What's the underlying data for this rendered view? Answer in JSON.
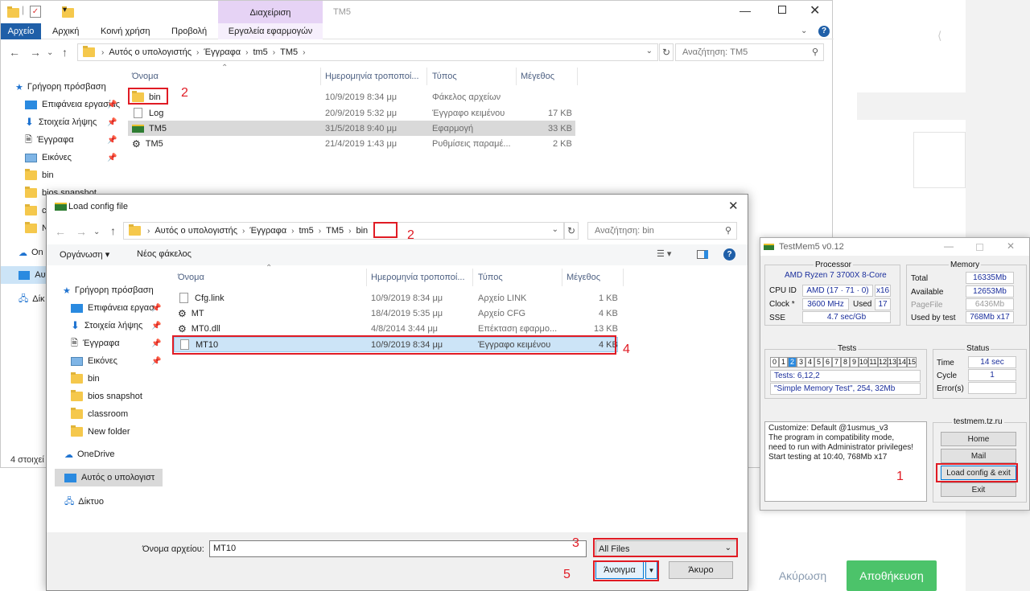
{
  "web": {
    "cancel_label": "Ακύρωση",
    "save_label": "Αποθήκευση"
  },
  "explorer": {
    "ribbon_context": "Διαχείριση",
    "window_title": "TM5",
    "tabs": [
      "Αρχείο",
      "Αρχική",
      "Κοινή χρήση",
      "Προβολή",
      "Εργαλεία εφαρμογών"
    ],
    "breadcrumb": [
      "Αυτός ο υπολογιστής",
      "Έγγραφα",
      "tm5",
      "TM5"
    ],
    "search_placeholder": "Αναζήτηση: TM5",
    "columns": [
      "Όνομα",
      "Ημερομηνία τροποποί...",
      "Τύπος",
      "Μέγεθος"
    ],
    "sidebar": [
      {
        "label": "Γρήγορη πρόσβαση",
        "icon": "star-icon"
      },
      {
        "label": "Επιφάνεια εργασίας",
        "icon": "desktop-icon",
        "pinned": true
      },
      {
        "label": "Στοιχεία λήψης",
        "icon": "download-icon",
        "pinned": true
      },
      {
        "label": "Έγγραφα",
        "icon": "document-icon",
        "pinned": true
      },
      {
        "label": "Εικόνες",
        "icon": "pictures-icon",
        "pinned": true
      },
      {
        "label": "bin",
        "icon": "folder-icon"
      },
      {
        "label": "bios snapshot",
        "icon": "folder-icon"
      },
      {
        "label": "cl",
        "icon": "folder-icon"
      },
      {
        "label": "N",
        "icon": "folder-icon"
      },
      {
        "label": "On",
        "icon": "onedrive-icon"
      },
      {
        "label": "Αυτ",
        "icon": "computer-icon"
      },
      {
        "label": "Δίκ",
        "icon": "network-icon"
      }
    ],
    "files": [
      {
        "name": "bin",
        "date": "10/9/2019 8:34 μμ",
        "type": "Φάκελος αρχείων",
        "size": "",
        "icon": "folder-icon"
      },
      {
        "name": "Log",
        "date": "20/9/2019 5:32 μμ",
        "type": "Έγγραφο κειμένου",
        "size": "17 KB",
        "icon": "text-file-icon"
      },
      {
        "name": "TM5",
        "date": "31/5/2018 9:40 μμ",
        "type": "Εφαρμογή",
        "size": "33 KB",
        "icon": "ram-app-icon"
      },
      {
        "name": "TM5",
        "date": "21/4/2019 1:43 μμ",
        "type": "Ρυθμίσεις παραμέ...",
        "size": "2 KB",
        "icon": "settings-file-icon"
      }
    ],
    "status": "4 στοιχεί"
  },
  "dialog": {
    "title": "Load config file",
    "breadcrumb": [
      "Αυτός ο υπολογιστής",
      "Έγγραφα",
      "tm5",
      "TM5",
      "bin"
    ],
    "search_placeholder": "Αναζήτηση: bin",
    "organize": "Οργάνωση",
    "new_folder": "Νέος φάκελος",
    "columns": [
      "Όνομα",
      "Ημερομηνία τροποποί...",
      "Τύπος",
      "Μέγεθος"
    ],
    "sidebar": [
      {
        "label": "Γρήγορη πρόσβαση",
        "icon": "star-icon"
      },
      {
        "label": "Επιφάνεια εργασ",
        "icon": "desktop-icon",
        "pinned": true
      },
      {
        "label": "Στοιχεία λήψης",
        "icon": "download-icon",
        "pinned": true
      },
      {
        "label": "Έγγραφα",
        "icon": "document-icon",
        "pinned": true
      },
      {
        "label": "Εικόνες",
        "icon": "pictures-icon",
        "pinned": true
      },
      {
        "label": "bin",
        "icon": "folder-icon"
      },
      {
        "label": "bios snapshot",
        "icon": "folder-icon"
      },
      {
        "label": "classroom",
        "icon": "folder-icon"
      },
      {
        "label": "New folder",
        "icon": "folder-icon"
      },
      {
        "label": "OneDrive",
        "icon": "onedrive-icon"
      },
      {
        "label": "Αυτός ο υπολογιστ",
        "icon": "computer-icon"
      },
      {
        "label": "Δίκτυο",
        "icon": "network-icon"
      }
    ],
    "files": [
      {
        "name": "Cfg.link",
        "date": "10/9/2019 8:34 μμ",
        "type": "Αρχείο LINK",
        "size": "1 KB",
        "icon": "file-icon"
      },
      {
        "name": "MT",
        "date": "18/4/2019 5:35 μμ",
        "type": "Αρχείο CFG",
        "size": "4 KB",
        "icon": "settings-file-icon"
      },
      {
        "name": "MT0.dll",
        "date": "4/8/2014 3:44 μμ",
        "type": "Επέκταση εφαρμο...",
        "size": "13 KB",
        "icon": "dll-file-icon"
      },
      {
        "name": "MT10",
        "date": "10/9/2019 8:34 μμ",
        "type": "Έγγραφο κειμένου",
        "size": "4 KB",
        "icon": "text-file-icon"
      }
    ],
    "filename_label": "Όνομα αρχείου:",
    "filename_value": "MT10",
    "filter": "All Files",
    "open": "Άνοιγμα",
    "cancel": "Άκυρο"
  },
  "testmem": {
    "title": "TestMem5 v0.12",
    "processor_title": "Processor",
    "cpu_name": "AMD Ryzen 7 3700X 8-Core",
    "cpu_id_label": "CPU ID",
    "cpu_id": "AMD  (17 · 71 · 0)",
    "cpu_threads": "x16",
    "clock_label": "Clock *",
    "clock": "3600 MHz",
    "used_label": "Used",
    "used": "17",
    "sse_label": "SSE",
    "sse": "4.7 sec/Gb",
    "memory_title": "Memory",
    "total_label": "Total",
    "total": "16335Mb",
    "available_label": "Available",
    "available": "12653Mb",
    "pagefile_label": "PageFile",
    "pagefile": "6436Mb",
    "usedbytest_label": "Used by test",
    "usedbytest": "768Mb x17",
    "tests_title": "Tests",
    "test_numbers": [
      "0",
      "1",
      "2",
      "3",
      "4",
      "5",
      "6",
      "7",
      "8",
      "9",
      "10",
      "11",
      "12",
      "13",
      "14",
      "15"
    ],
    "active_test": "2",
    "tests_list": "Tests: 6,12,2",
    "current_test": "\"Simple Memory Test\", 254, 32Mb",
    "status_title": "Status",
    "time_label": "Time",
    "time": "14 sec",
    "cycle_label": "Cycle",
    "cycle": "1",
    "errors_label": "Error(s)",
    "errors": "",
    "log": [
      "Customize: Default @1usmus_v3",
      "The program in compatibility mode,",
      "need to run with Administrator privileges!",
      "Start testing at 10:40, 768Mb x17"
    ],
    "site": "testmem.tz.ru",
    "home": "Home",
    "mail": "Mail",
    "load": "Load config & exit",
    "exit": "Exit"
  },
  "annotations": [
    "1",
    "2",
    "2",
    "3",
    "4",
    "5"
  ]
}
